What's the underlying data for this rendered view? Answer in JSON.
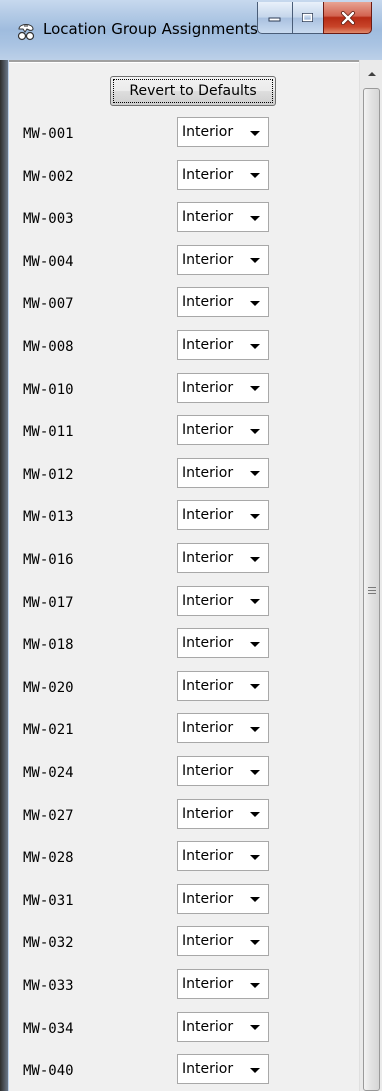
{
  "window": {
    "title": "Location Group Assignments",
    "icon": "app-logo-icon",
    "controls": {
      "minimize": "minimize-icon",
      "maximize": "maximize-icon",
      "close": "close-icon"
    }
  },
  "toolbar": {
    "revert_label": "Revert to Defaults"
  },
  "rows": [
    {
      "id": "MW-001",
      "group": "Interior"
    },
    {
      "id": "MW-002",
      "group": "Interior"
    },
    {
      "id": "MW-003",
      "group": "Interior"
    },
    {
      "id": "MW-004",
      "group": "Interior"
    },
    {
      "id": "MW-007",
      "group": "Interior"
    },
    {
      "id": "MW-008",
      "group": "Interior"
    },
    {
      "id": "MW-010",
      "group": "Interior"
    },
    {
      "id": "MW-011",
      "group": "Interior"
    },
    {
      "id": "MW-012",
      "group": "Interior"
    },
    {
      "id": "MW-013",
      "group": "Interior"
    },
    {
      "id": "MW-016",
      "group": "Interior"
    },
    {
      "id": "MW-017",
      "group": "Interior"
    },
    {
      "id": "MW-018",
      "group": "Interior"
    },
    {
      "id": "MW-020",
      "group": "Interior"
    },
    {
      "id": "MW-021",
      "group": "Interior"
    },
    {
      "id": "MW-024",
      "group": "Interior"
    },
    {
      "id": "MW-027",
      "group": "Interior"
    },
    {
      "id": "MW-028",
      "group": "Interior"
    },
    {
      "id": "MW-031",
      "group": "Interior"
    },
    {
      "id": "MW-032",
      "group": "Interior"
    },
    {
      "id": "MW-033",
      "group": "Interior"
    },
    {
      "id": "MW-034",
      "group": "Interior"
    },
    {
      "id": "MW-040",
      "group": "Interior"
    }
  ]
}
